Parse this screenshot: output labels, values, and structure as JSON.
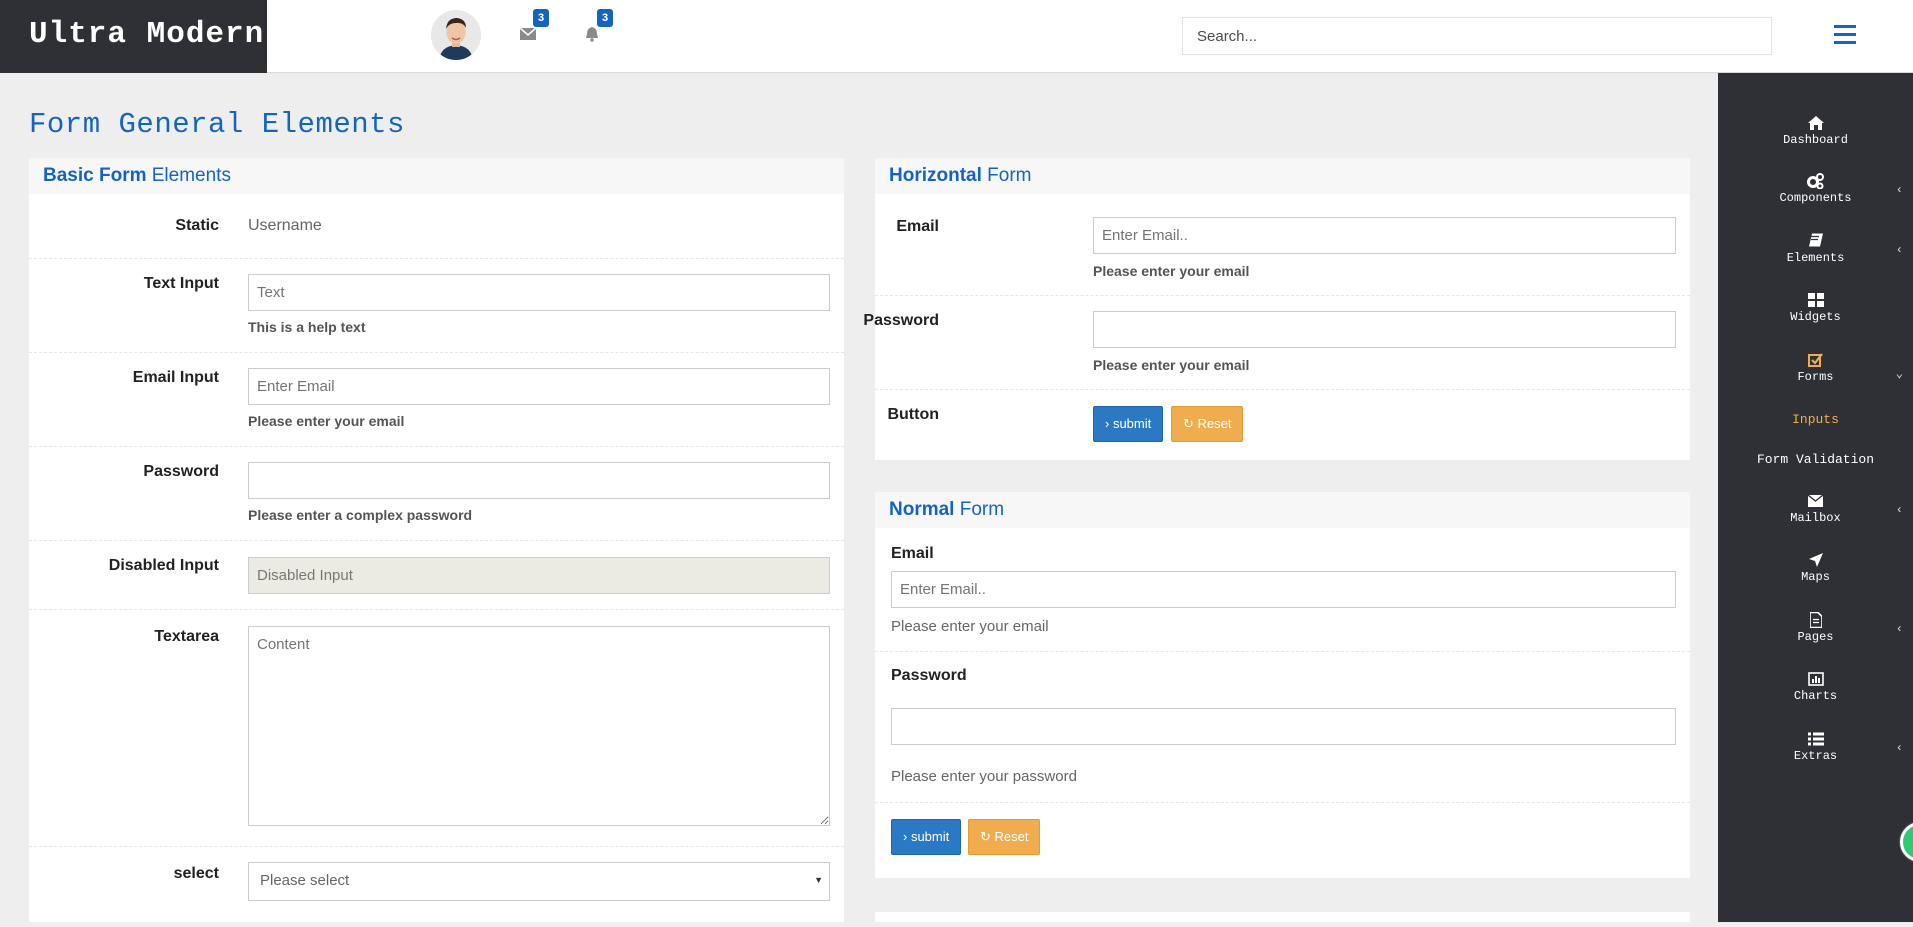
{
  "header": {
    "brand": "Ultra Modern",
    "messages_badge": "3",
    "notifications_badge": "3",
    "search_placeholder": "Search..."
  },
  "page_title": "Form General Elements",
  "basic_form": {
    "title_bold": "Basic Form",
    "title_rest": " Elements",
    "static_label": "Static",
    "static_value": "Username",
    "text_label": "Text Input",
    "text_placeholder": "Text",
    "text_help": "This is a help text",
    "email_label": "Email Input",
    "email_placeholder": "Enter Email",
    "email_help": "Please enter your email",
    "password_label": "Password",
    "password_help": "Please enter a complex password",
    "disabled_label": "Disabled Input",
    "disabled_value": "Disabled Input",
    "textarea_label": "Textarea",
    "textarea_placeholder": "Content",
    "select_label": "select",
    "select_value": "Please select"
  },
  "horizontal_form": {
    "title_bold": "Horizontal",
    "title_rest": " Form",
    "email_label": "Email",
    "email_placeholder": "Enter Email..",
    "email_help": "Please enter your email",
    "password_label": "Password",
    "password_help": "Please enter your email",
    "button_label": "Button",
    "submit": "› submit",
    "reset": "Reset"
  },
  "normal_form": {
    "title_bold": "Normal",
    "title_rest": " Form",
    "email_label": "Email",
    "email_placeholder": "Enter Email..",
    "email_help": "Please enter your email",
    "password_label": "Password",
    "password_help": "Please enter your password",
    "submit": "› submit",
    "reset": "Reset"
  },
  "sidebar": {
    "items": [
      {
        "label": "Dashboard",
        "icon": "home-icon",
        "chevron": ""
      },
      {
        "label": "Components",
        "icon": "cogs-icon",
        "chevron": "‹"
      },
      {
        "label": "Elements",
        "icon": "book-icon",
        "chevron": "‹"
      },
      {
        "label": "Widgets",
        "icon": "th-large-icon",
        "chevron": ""
      },
      {
        "label": "Forms",
        "icon": "check-square-icon",
        "chevron": "⌄"
      },
      {
        "label": "Inputs",
        "icon": "",
        "chevron": ""
      },
      {
        "label": "Form Validation",
        "icon": "",
        "chevron": ""
      },
      {
        "label": "Mailbox",
        "icon": "envelope-icon",
        "chevron": "‹"
      },
      {
        "label": "Maps",
        "icon": "location-arrow-icon",
        "chevron": ""
      },
      {
        "label": "Pages",
        "icon": "file-icon",
        "chevron": "‹"
      },
      {
        "label": "Charts",
        "icon": "bar-chart-icon",
        "chevron": ""
      },
      {
        "label": "Extras",
        "icon": "list-icon",
        "chevron": "‹"
      }
    ],
    "active_color": "#f0ad4e"
  },
  "colors": {
    "accent": "#1565c0",
    "primary_button": "#2b78c5",
    "warning_button": "#f0ad4e",
    "sidebar_bg": "#2e3035"
  }
}
